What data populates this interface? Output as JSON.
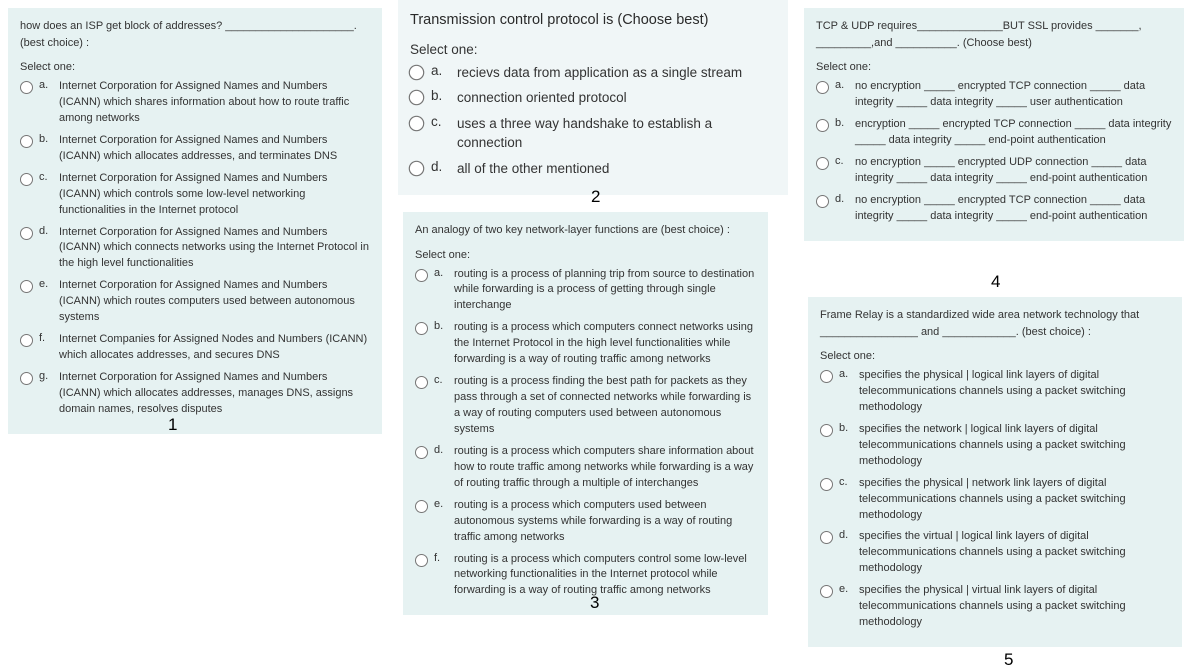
{
  "questions": [
    {
      "id": 1,
      "prompt": "how does an ISP get block of addresses? _____________________. (best choice) :",
      "select_label": "Select one:",
      "options": [
        {
          "letter": "a.",
          "text": "Internet Corporation for Assigned Names and Numbers (ICANN) which shares information about how to route traffic among networks"
        },
        {
          "letter": "b.",
          "text": "Internet Corporation for Assigned Names and Numbers (ICANN) which allocates addresses, and terminates DNS"
        },
        {
          "letter": "c.",
          "text": "Internet Corporation for Assigned Names and Numbers (ICANN) which controls some low-level networking functionalities in the Internet protocol"
        },
        {
          "letter": "d.",
          "text": "Internet Corporation for Assigned Names and Numbers (ICANN) which connects networks using the Internet Protocol in the high level functionalities"
        },
        {
          "letter": "e.",
          "text": "Internet Corporation for Assigned Names and Numbers (ICANN) which routes computers used between autonomous systems"
        },
        {
          "letter": "f.",
          "text": "Internet Companies for Assigned Nodes and Numbers (ICANN) which allocates addresses, and secures DNS"
        },
        {
          "letter": "g.",
          "text": "Internet Corporation for Assigned Names and Numbers (ICANN) which allocates addresses, manages DNS, assigns domain names, resolves disputes"
        }
      ]
    },
    {
      "id": 2,
      "prompt": "Transmission control protocol is (Choose best)",
      "select_label": "Select one:",
      "options": [
        {
          "letter": "a.",
          "text": "recievs data from application as a single stream"
        },
        {
          "letter": "b.",
          "text": "connection oriented protocol"
        },
        {
          "letter": "c.",
          "text": "uses a three way handshake to establish a connection"
        },
        {
          "letter": "d.",
          "text": "all of the other mentioned"
        }
      ]
    },
    {
      "id": 3,
      "prompt": "An analogy of two key network-layer functions are (best choice) :",
      "select_label": "Select one:",
      "options": [
        {
          "letter": "a.",
          "text": "routing is a process of planning trip from source to destination while forwarding is a process of getting through single interchange"
        },
        {
          "letter": "b.",
          "text": "routing is a process which computers connect networks using the Internet Protocol in the high level functionalities while forwarding is a way of routing traffic among networks"
        },
        {
          "letter": "c.",
          "text": "routing is a process finding the best path for packets as they pass through a set of connected networks while forwarding is a way of routing computers used between autonomous systems"
        },
        {
          "letter": "d.",
          "text": "routing is a process which computers share information about how to route traffic among networks while forwarding is a way of routing traffic through a multiple of interchanges"
        },
        {
          "letter": "e.",
          "text": "routing is a process which computers used between autonomous systems while forwarding is a way of routing traffic among networks"
        },
        {
          "letter": "f.",
          "text": "routing is a process which computers control some low-level networking functionalities in the Internet protocol while forwarding is a way of routing traffic among networks"
        }
      ]
    },
    {
      "id": 4,
      "prompt": "TCP & UDP requires______________BUT SSL provides _______, _________,and __________. (Choose best)",
      "select_label": "Select one:",
      "options": [
        {
          "letter": "a.",
          "text": "no encryption _____ encrypted TCP connection _____ data integrity _____ data integrity _____ user authentication"
        },
        {
          "letter": "b.",
          "text": "encryption _____ encrypted TCP connection _____ data integrity _____ data integrity _____ end-point authentication"
        },
        {
          "letter": "c.",
          "text": "no encryption _____ encrypted UDP connection _____ data integrity _____ data integrity _____ end-point authentication"
        },
        {
          "letter": "d.",
          "text": "no encryption _____ encrypted TCP connection _____ data integrity _____ data integrity _____ end-point authentication"
        }
      ]
    },
    {
      "id": 5,
      "prompt": "Frame Relay is a standardized wide area network technology that ________________ and ____________. (best choice) :",
      "select_label": "Select one:",
      "options": [
        {
          "letter": "a.",
          "text": "specifies the physical | logical link layers of digital telecommunications channels using a packet switching methodology"
        },
        {
          "letter": "b.",
          "text": "specifies the network | logical link layers of digital telecommunications channels using a packet switching methodology"
        },
        {
          "letter": "c.",
          "text": "specifies the physical | network link layers of digital telecommunications channels using a packet switching methodology"
        },
        {
          "letter": "d.",
          "text": "specifies the virtual | logical link layers of digital telecommunications channels using a packet switching methodology"
        },
        {
          "letter": "e.",
          "text": "specifies the physical | virtual link layers of digital telecommunications channels using a packet switching methodology"
        }
      ]
    }
  ],
  "qnums": {
    "1": "1",
    "2": "2",
    "3": "3",
    "4": "4",
    "5": "5"
  }
}
